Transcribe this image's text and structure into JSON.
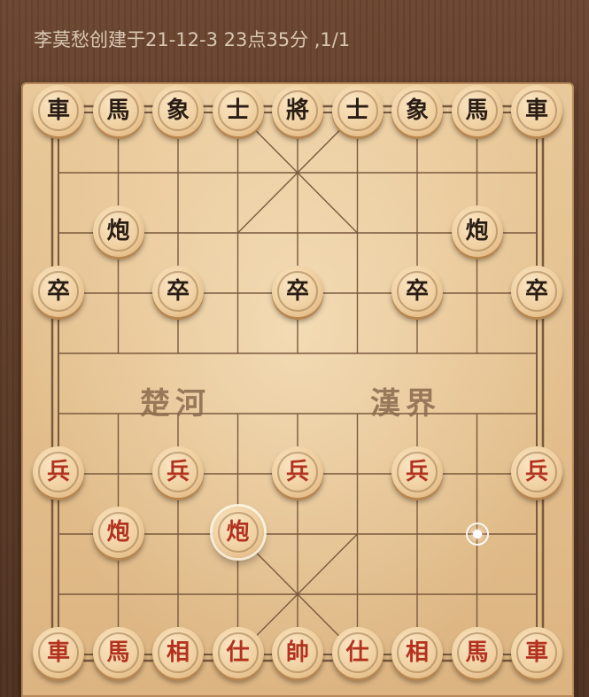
{
  "header": {
    "title": "李莫愁创建于21-12-3 23点35分  ,1/1"
  },
  "river": {
    "left": "楚河",
    "right": "漢界"
  },
  "colors": {
    "red": "#b3321f",
    "black": "#2a1d14"
  },
  "pieces": [
    {
      "ch": "車",
      "side": "black",
      "file": 0,
      "rank": 0
    },
    {
      "ch": "馬",
      "side": "black",
      "file": 1,
      "rank": 0
    },
    {
      "ch": "象",
      "side": "black",
      "file": 2,
      "rank": 0
    },
    {
      "ch": "士",
      "side": "black",
      "file": 3,
      "rank": 0
    },
    {
      "ch": "將",
      "side": "black",
      "file": 4,
      "rank": 0
    },
    {
      "ch": "士",
      "side": "black",
      "file": 5,
      "rank": 0
    },
    {
      "ch": "象",
      "side": "black",
      "file": 6,
      "rank": 0
    },
    {
      "ch": "馬",
      "side": "black",
      "file": 7,
      "rank": 0
    },
    {
      "ch": "車",
      "side": "black",
      "file": 8,
      "rank": 0
    },
    {
      "ch": "炮",
      "side": "black",
      "file": 1,
      "rank": 2
    },
    {
      "ch": "炮",
      "side": "black",
      "file": 7,
      "rank": 2
    },
    {
      "ch": "卒",
      "side": "black",
      "file": 0,
      "rank": 3
    },
    {
      "ch": "卒",
      "side": "black",
      "file": 2,
      "rank": 3
    },
    {
      "ch": "卒",
      "side": "black",
      "file": 4,
      "rank": 3
    },
    {
      "ch": "卒",
      "side": "black",
      "file": 6,
      "rank": 3
    },
    {
      "ch": "卒",
      "side": "black",
      "file": 8,
      "rank": 3
    },
    {
      "ch": "兵",
      "side": "red",
      "file": 0,
      "rank": 6
    },
    {
      "ch": "兵",
      "side": "red",
      "file": 2,
      "rank": 6
    },
    {
      "ch": "兵",
      "side": "red",
      "file": 4,
      "rank": 6
    },
    {
      "ch": "兵",
      "side": "red",
      "file": 6,
      "rank": 6
    },
    {
      "ch": "兵",
      "side": "red",
      "file": 8,
      "rank": 6
    },
    {
      "ch": "炮",
      "side": "red",
      "file": 1,
      "rank": 7
    },
    {
      "ch": "炮",
      "side": "red",
      "file": 3,
      "rank": 7,
      "selected": true
    },
    {
      "ch": "車",
      "side": "red",
      "file": 0,
      "rank": 9
    },
    {
      "ch": "馬",
      "side": "red",
      "file": 1,
      "rank": 9
    },
    {
      "ch": "相",
      "side": "red",
      "file": 2,
      "rank": 9
    },
    {
      "ch": "仕",
      "side": "red",
      "file": 3,
      "rank": 9
    },
    {
      "ch": "帥",
      "side": "red",
      "file": 4,
      "rank": 9
    },
    {
      "ch": "仕",
      "side": "red",
      "file": 5,
      "rank": 9
    },
    {
      "ch": "相",
      "side": "red",
      "file": 6,
      "rank": 9
    },
    {
      "ch": "馬",
      "side": "red",
      "file": 7,
      "rank": 9
    },
    {
      "ch": "車",
      "side": "red",
      "file": 8,
      "rank": 9
    }
  ],
  "last_move_target": {
    "file": 7,
    "rank": 7
  }
}
